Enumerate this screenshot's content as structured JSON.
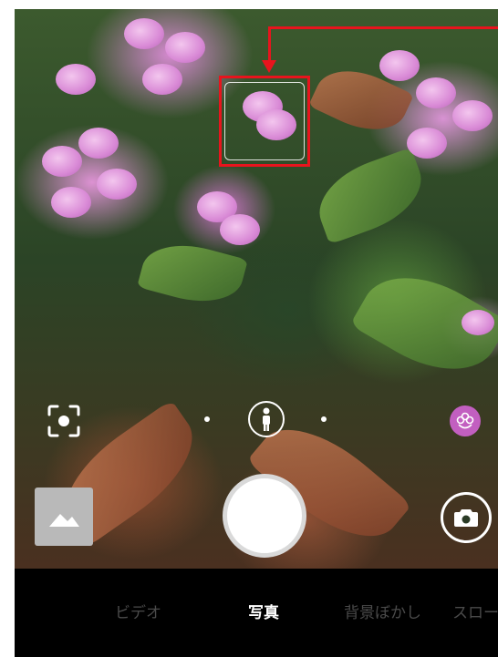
{
  "camera": {
    "modes": [
      {
        "label": "ビデオ",
        "active": false
      },
      {
        "label": "写真",
        "active": true
      },
      {
        "label": "背景ぼかし",
        "active": false
      },
      {
        "label": "スロー",
        "active": false
      }
    ],
    "icons": {
      "lens": "lens-scan-icon",
      "portrait": "portrait-person-icon",
      "filter": "flower-filter-icon",
      "gallery": "gallery-thumbnail-icon",
      "flip": "camera-flip-icon"
    },
    "colors": {
      "annotation": "#e8141d",
      "filter_button": "#c25fc0",
      "mode_bar": "#000000"
    }
  }
}
